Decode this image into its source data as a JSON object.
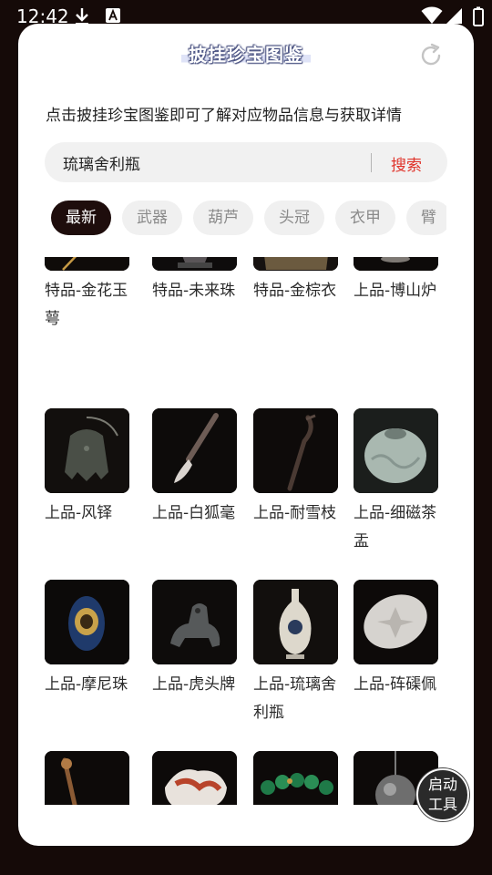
{
  "status_bar": {
    "time": "12:42"
  },
  "header": {
    "title": "披挂珍宝图鉴"
  },
  "intro": "点击披挂珍宝图鉴即可了解对应物品信息与获取详情",
  "search": {
    "value": "琉璃舍利瓶",
    "button": "搜索"
  },
  "tabs": [
    {
      "label": "最新",
      "active": true
    },
    {
      "label": "武器"
    },
    {
      "label": "葫芦"
    },
    {
      "label": "头冠"
    },
    {
      "label": "衣甲"
    },
    {
      "label": "臂"
    }
  ],
  "items": [
    {
      "label": "特品-金花玉萼",
      "icon": "gold-hairpin"
    },
    {
      "label": "特品-未来珠",
      "icon": "orb-on-stand"
    },
    {
      "label": "特品-金棕衣",
      "icon": "gold-robe"
    },
    {
      "label": "上品-博山炉",
      "icon": "incense-burner"
    },
    {
      "label": "上品-风铎",
      "icon": "wind-bell"
    },
    {
      "label": "上品-白狐毫",
      "icon": "brush"
    },
    {
      "label": "上品-耐雪枝",
      "icon": "branch"
    },
    {
      "label": "上品-细磁茶盂",
      "icon": "celadon-pot"
    },
    {
      "label": "上品-摩尼珠",
      "icon": "mani-pearl"
    },
    {
      "label": "上品-虎头牌",
      "icon": "tiger-figurine"
    },
    {
      "label": "上品-琉璃舍利瓶",
      "icon": "vase"
    },
    {
      "label": "上品-砗磲佩",
      "icon": "shell-pendant"
    },
    {
      "label": "",
      "icon": "staff"
    },
    {
      "label": "",
      "icon": "carved-coral"
    },
    {
      "label": "",
      "icon": "bead-bracelet"
    },
    {
      "label": "",
      "icon": "silver-orb"
    }
  ],
  "fab": {
    "label": "启动工具"
  }
}
